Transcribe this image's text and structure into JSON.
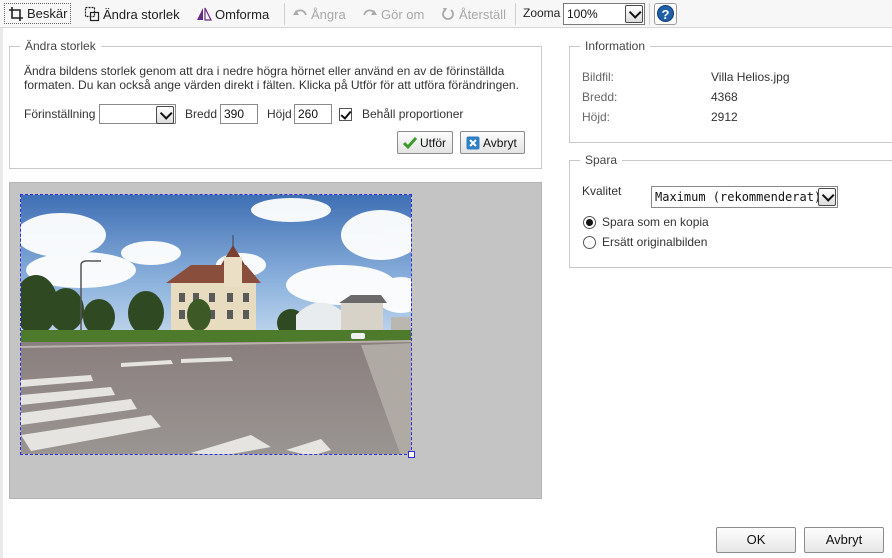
{
  "toolbar": {
    "crop_label": "Beskär",
    "resize_label": "Ändra storlek",
    "transform_label": "Omforma",
    "undo_label": "Ångra",
    "redo_label": "Gör om",
    "reset_label": "Återställ",
    "zoom_label": "Zooma",
    "zoom_value": "100%",
    "help_label": "?"
  },
  "resize_panel": {
    "legend": "Ändra storlek",
    "description": "Ändra bildens storlek genom att dra i nedre högra hörnet eller använd en av de förinställda formaten. Du kan också ange värden direkt i fälten. Klicka på Utför för att utföra förändringen.",
    "preset_label": "Förinställning",
    "preset_value": "",
    "width_label": "Bredd",
    "width_value": "390",
    "height_label": "Höjd",
    "height_value": "260",
    "keep_ratio_label": "Behåll proportioner",
    "keep_ratio_checked": true,
    "apply_label": "Utför",
    "cancel_label": "Avbryt"
  },
  "info_panel": {
    "legend": "Information",
    "file_label": "Bildfil:",
    "file_value": "Villa Helios.jpg",
    "width_label": "Bredd:",
    "width_value": "4368",
    "height_label": "Höjd:",
    "height_value": "2912"
  },
  "save_panel": {
    "legend": "Spara",
    "quality_label": "Kvalitet",
    "quality_value": "Maximum (rekommenderat)",
    "save_copy_label": "Spara som en kopia",
    "replace_label": "Ersätt originalbilden",
    "selected": "save_copy"
  },
  "footer": {
    "ok_label": "OK",
    "cancel_label": "Avbryt"
  },
  "colors": {
    "selection_border": "#2d2de0",
    "canvas_bg": "#c4c4c4",
    "apply_icon": "#3a9a2a",
    "cancel_icon": "#2f7fc4"
  }
}
